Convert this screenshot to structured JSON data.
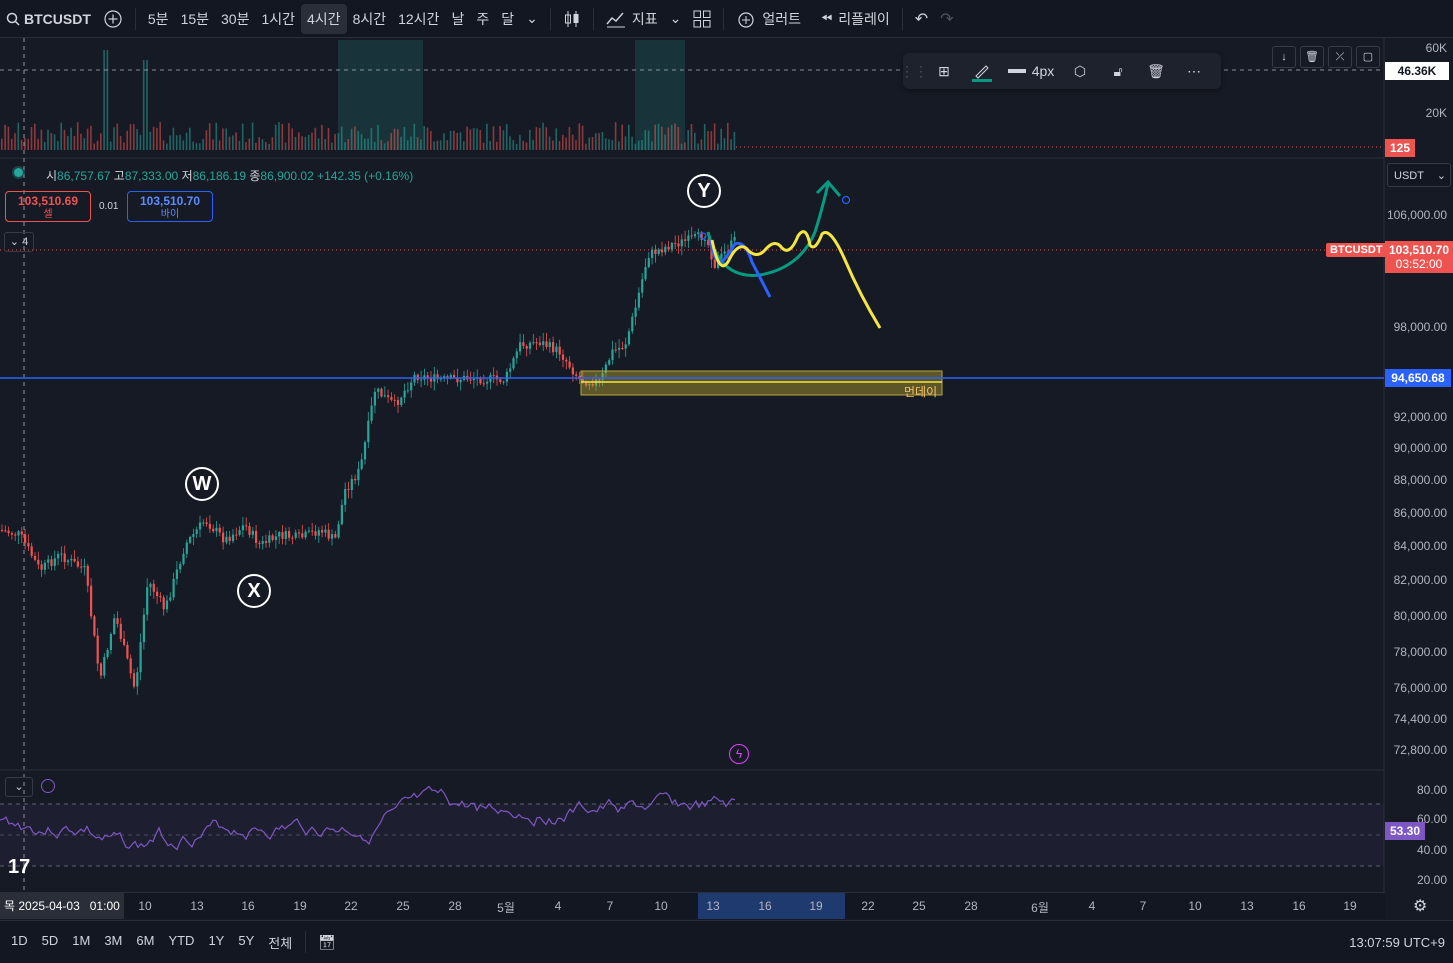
{
  "toolbar": {
    "symbol": "BTCUSDT",
    "intervals": [
      "5분",
      "15분",
      "30분",
      "1시간",
      "4시간",
      "8시간",
      "12시간",
      "날",
      "주",
      "달"
    ],
    "active_interval": "4시간",
    "indicators_label": "지표",
    "alert_label": "얼러트",
    "replay_label": "리플레이"
  },
  "drawing_toolbar": {
    "width_label": "4px"
  },
  "ohlc": {
    "open_key": "시",
    "open": "86,757.67",
    "high_key": "고",
    "high": "87,333.00",
    "low_key": "저",
    "low": "86,186.19",
    "close_key": "종",
    "close": "86,900.02",
    "change": "+142.35 (+0.16%)"
  },
  "orders": {
    "sell_price": "103,510.69",
    "sell_label": "셀",
    "spread": "0.01",
    "buy_price": "103,510.70",
    "buy_label": "바이"
  },
  "collapse_count": "4",
  "currency": "USDT",
  "volume_axis": [
    "60K",
    "20K"
  ],
  "volume_tag": "46.36K",
  "volume_tag2": "125",
  "price_axis": [
    "106,000.00",
    "98,000.00",
    "92,000.00",
    "90,000.00",
    "88,000.00",
    "86,000.00",
    "84,000.00",
    "82,000.00",
    "80,000.00",
    "78,000.00",
    "76,000.00",
    "74,400.00",
    "72,800.00"
  ],
  "last_price": {
    "symbol": "BTCUSDT",
    "price": "103,510.70",
    "countdown": "03:52:00"
  },
  "hline": {
    "price": "94,650.68",
    "color": "#2962ff"
  },
  "zone_label": "먼데이",
  "waves": [
    "W",
    "X",
    "Y"
  ],
  "rsi_axis": [
    "80.00",
    "60.00",
    "40.00",
    "20.00"
  ],
  "rsi_value": "53.30",
  "time_axis": {
    "cursor_label": "목 2025-04-03   01:00",
    "ticks": [
      "10",
      "13",
      "16",
      "19",
      "22",
      "25",
      "28",
      "5월",
      "4",
      "7",
      "10",
      "13",
      "16",
      "19",
      "22",
      "25",
      "28",
      "6월",
      "4",
      "7",
      "10",
      "13",
      "16",
      "19"
    ]
  },
  "ranges": [
    "1D",
    "5D",
    "1M",
    "3M",
    "6M",
    "YTD",
    "1Y",
    "5Y",
    "전체"
  ],
  "clock": "13:07:59 UTC+9",
  "colors": {
    "up": "#26a69a",
    "down": "#ef5350",
    "rsi": "#7e57c2",
    "yellow": "#f5e642",
    "green_arrow": "#089981",
    "blue_path": "#2962ff"
  }
}
